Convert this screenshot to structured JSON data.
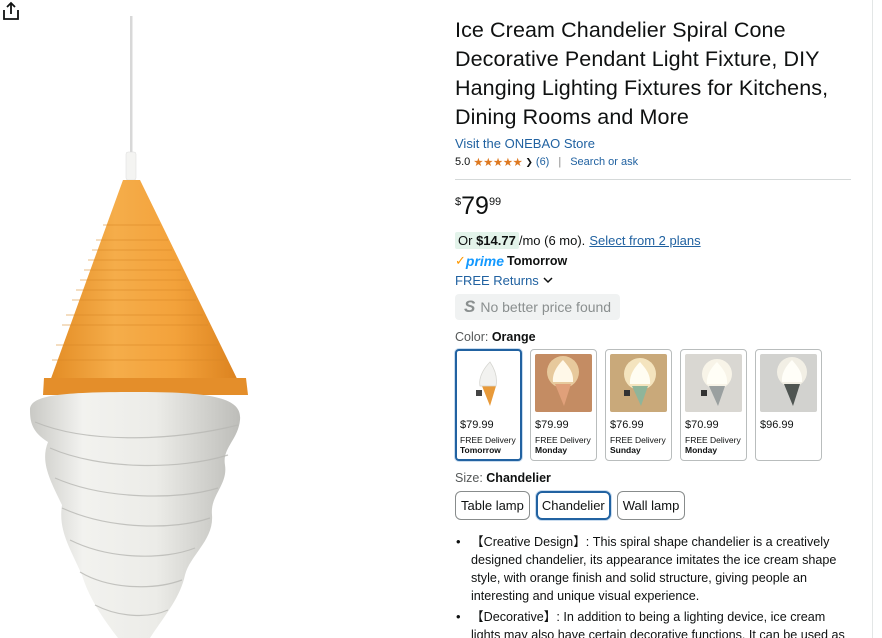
{
  "product": {
    "title": "Ice Cream Chandelier Spiral Cone Decorative Pendant Light Fixture, DIY Hanging Lighting Fixtures for Kitchens, Dining Rooms and More",
    "store_link": "Visit the ONEBAO Store",
    "rating_value": "5.0",
    "stars": "★★★★★",
    "rating_count": "(6)",
    "search_ask": "Search or ask"
  },
  "price": {
    "symbol": "$",
    "whole": "79",
    "fraction": "99"
  },
  "installment": {
    "prefix": "Or",
    "amount": "$14.77",
    "suffix": "/mo (6 mo).",
    "link": "Select from 2 plans"
  },
  "delivery": {
    "prime_check": "✓",
    "prime_word": "prime",
    "prime_day": "Tomorrow",
    "returns": "FREE Returns"
  },
  "no_better_price": {
    "glyph": "S",
    "text": "No better price found"
  },
  "color": {
    "label": "Color:",
    "selected": "Orange",
    "options": [
      {
        "price": "$79.99",
        "delivery_1": "FREE Delivery",
        "delivery_2": "Tomorrow"
      },
      {
        "price": "$79.99",
        "delivery_1": "FREE Delivery",
        "delivery_2": "Monday"
      },
      {
        "price": "$76.99",
        "delivery_1": "FREE Delivery",
        "delivery_2": "Sunday"
      },
      {
        "price": "$70.99",
        "delivery_1": "FREE Delivery",
        "delivery_2": "Monday"
      },
      {
        "price": "$96.99",
        "delivery_1": "",
        "delivery_2": ""
      }
    ]
  },
  "size": {
    "label": "Size:",
    "selected": "Chandelier",
    "options": [
      "Table lamp",
      "Chandelier",
      "Wall lamp"
    ]
  },
  "bullets": [
    "【Creative Design】: This spiral shape chandelier is a creatively designed chandelier, its appearance imitates the ice cream shape style, with orange finish and solid structure, giving people an interesting and unique visual experience.",
    "【Decorative】: In addition to being a lighting device, ice cream lights may also have certain decorative functions. It can be used as"
  ],
  "colors": {
    "link": "#2162a1",
    "cone_orange": "#f0a23a",
    "swirl_white": "#eeeeea",
    "star_orange": "#de7921",
    "prime_blue": "#1399ff",
    "selected_border": "#2162a1"
  },
  "icons": {
    "share": "share-icon",
    "chevron": "chevron-down-icon",
    "prime_check": "check-icon"
  }
}
